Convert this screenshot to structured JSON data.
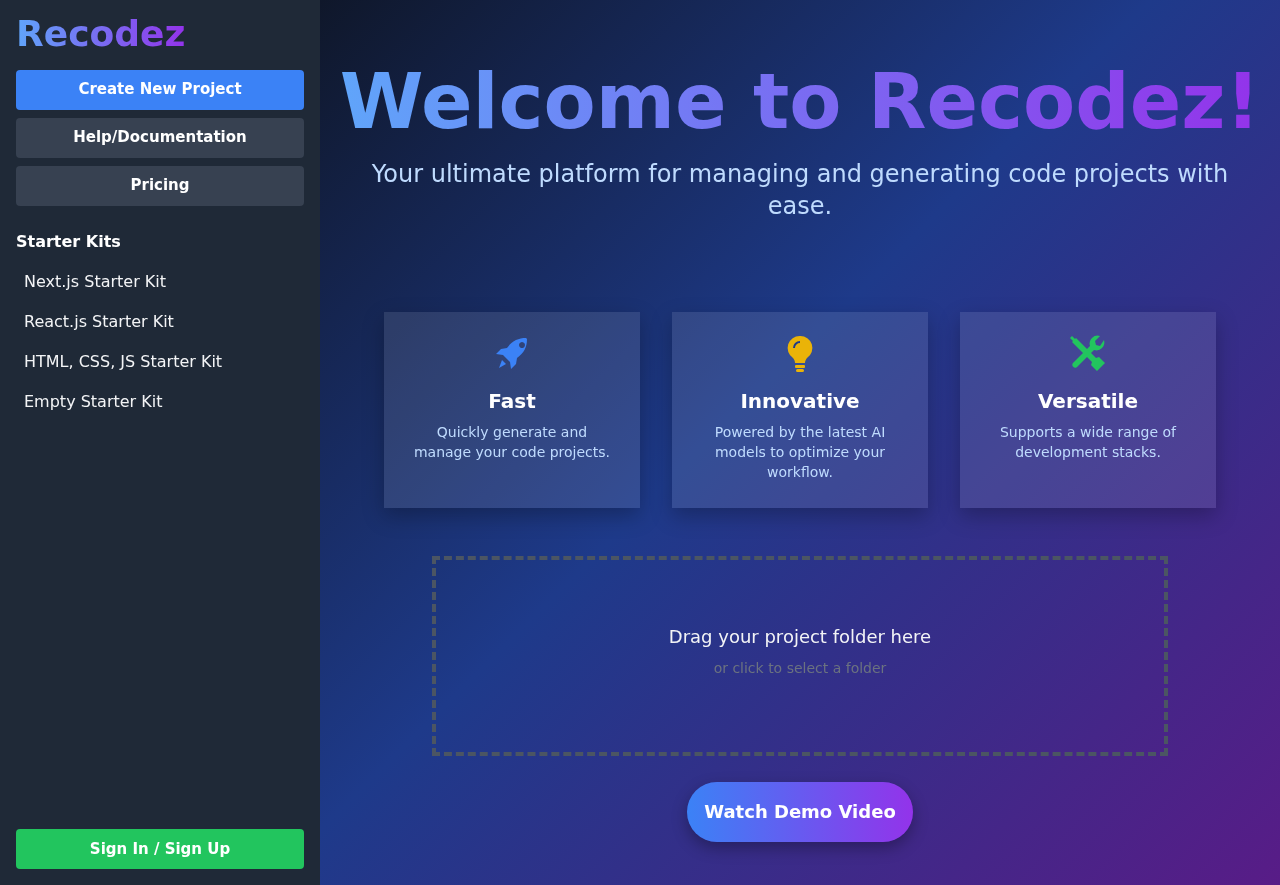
{
  "sidebar": {
    "logo": "Recodez",
    "buttons": [
      {
        "label": "Create New Project",
        "kind": "primary"
      },
      {
        "label": "Help/Documentation",
        "kind": "secondary"
      },
      {
        "label": "Pricing",
        "kind": "secondary"
      }
    ],
    "section_title": "Starter Kits",
    "starter_kits": [
      "Next.js Starter Kit",
      "React.js Starter Kit",
      "HTML, CSS, JS Starter Kit",
      "Empty Starter Kit"
    ],
    "sign_in": "Sign In / Sign Up"
  },
  "hero": {
    "title": "Welcome to Recodez!",
    "subtitle": "Your ultimate platform for managing and generating code projects with ease."
  },
  "features": [
    {
      "title": "Fast",
      "text": "Quickly generate and manage your code projects."
    },
    {
      "title": "Innovative",
      "text": "Powered by the latest AI models to optimize your workflow."
    },
    {
      "title": "Versatile",
      "text": "Supports a wide range of development stacks."
    }
  ],
  "dropzone": {
    "title": "Drag your project folder here",
    "hint": "or click to select a folder"
  },
  "demo_button": "Watch Demo Video"
}
